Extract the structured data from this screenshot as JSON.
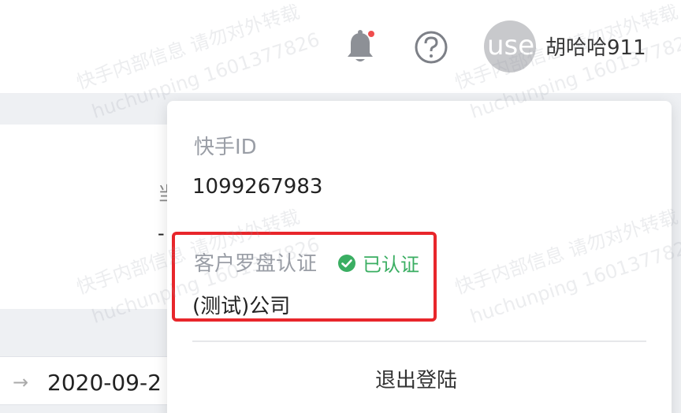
{
  "header": {
    "username": "胡哈哈911",
    "avatar_text": "user"
  },
  "background": {
    "card_text_1": "当",
    "card_text_2": "-",
    "date_value": "2020-09-2",
    "date_arrow": "→"
  },
  "dropdown": {
    "id_label": "快手ID",
    "id_value": "1099267983",
    "compass_label": "客户罗盘认证",
    "verified_text": "已认证",
    "company": "(测试)公司",
    "logout": "退出登陆"
  },
  "watermark": {
    "line1": "快手内部信息 请勿对外转载",
    "line2": "huchunping 1601377826"
  },
  "colors": {
    "highlight": "#e8262b",
    "verified": "#3aae62",
    "notification_dot": "#f04d4d"
  }
}
